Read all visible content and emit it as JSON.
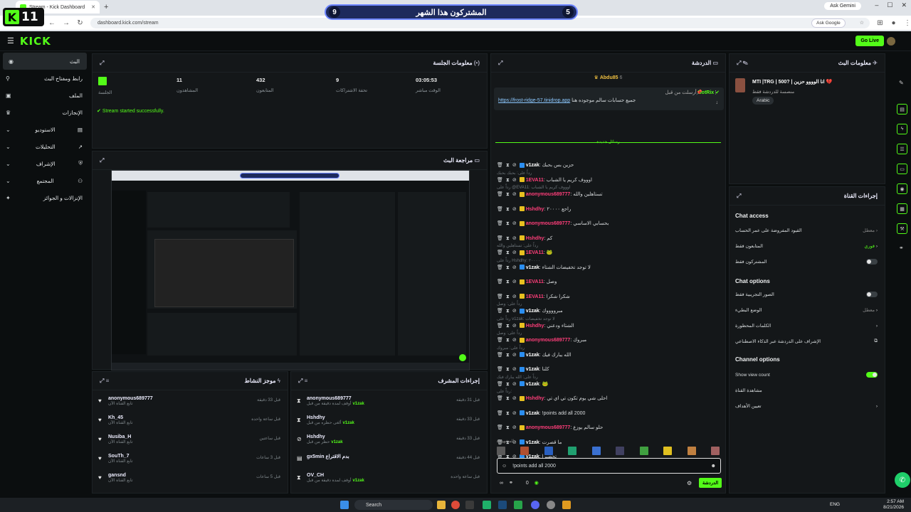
{
  "browser": {
    "tab_title": "Stream - Kick Dashboard",
    "url": "dashboard.kick.com/stream",
    "ask_google": "Ask Google",
    "ask_gemini": "Ask Gemini"
  },
  "overlay": {
    "k_letter": "K",
    "k_count": "11",
    "sub_left": "9",
    "sub_label": "المشتركون هذا الشهر",
    "sub_right": "5"
  },
  "header": {
    "logo": "KICK",
    "go_live": "Go Live"
  },
  "sidebar": {
    "items": [
      {
        "label": "البث",
        "icon": "broadcast-icon"
      },
      {
        "label": "رابط ومفتاح البث",
        "icon": "link-icon"
      },
      {
        "label": "الملف",
        "icon": "profile-icon"
      },
      {
        "label": "الإنجازات",
        "icon": "trophy-icon"
      },
      {
        "label": "الاستوديو",
        "icon": "studio-icon"
      },
      {
        "label": "التحليلات",
        "icon": "analytics-icon"
      },
      {
        "label": "الإشراف",
        "icon": "shield-icon"
      },
      {
        "label": "المجتمع",
        "icon": "community-icon"
      },
      {
        "label": "الإنزالات و الجوائز",
        "icon": "gift-icon"
      }
    ]
  },
  "session": {
    "title": "معلومات الجلسة",
    "stats": [
      {
        "value": "",
        "label": "الجلسة"
      },
      {
        "value": "11",
        "label": "المشاهدون"
      },
      {
        "value": "432",
        "label": "المتابعون"
      },
      {
        "value": "9",
        "label": "تحفة الاشتراكات"
      },
      {
        "value": "03:05:53",
        "label": "الوقت مباشر"
      }
    ],
    "status": "Stream started successfully."
  },
  "preview": {
    "title": "مراجعة البث"
  },
  "activity": {
    "title": "موجز النشاط",
    "rows": [
      {
        "name": "anonymous689777",
        "sub": "تابع القناة الآن",
        "time": "قبل 33 دقيقة"
      },
      {
        "name": "Kh_45",
        "sub": "تابع القناة الآن",
        "time": "قبل ساعة واحدة"
      },
      {
        "name": "Nusiba_H",
        "sub": "تابع القناة الآن",
        "time": "قبل ساعتين"
      },
      {
        "name": "SouTh_7",
        "sub": "تابع القناة الآن",
        "time": "قبل 3 ساعات"
      },
      {
        "name": "gansnd",
        "sub": "تابع القناة الآن",
        "time": "قبل 5 ساعات"
      }
    ]
  },
  "modactions": {
    "title": "إجراءات المشرف",
    "rows": [
      {
        "name": "anonymous689777",
        "sub": "أوقف لمدة دقيقة من قبل",
        "by": "v1zak",
        "time": "قبل 31 دقيقة"
      },
      {
        "name": "Hshdhy",
        "sub": "ألغى حظره من قبل",
        "by": "v1zak",
        "time": "قبل 33 دقيقة"
      },
      {
        "name": "Hshdhy",
        "sub": "حظر من قبل",
        "by": "v1zak",
        "time": "قبل 33 دقيقة"
      },
      {
        "name": "gx5min",
        "sub": "بدم الاقتراع",
        "by": "",
        "time": "قبل 44 دقيقة"
      },
      {
        "name": "OV_CH",
        "sub": "أوقف لمدة دقيقة من قبل",
        "by": "v1zak",
        "time": "قبل ساعة واحدة"
      }
    ]
  },
  "chat": {
    "title": "الدردشة",
    "pinned_user": "Abdu85",
    "pinned_count": "6",
    "bot_label": "أرسلت من قبل",
    "bot_name": "BotRix",
    "bot_msg": "جميع حسابات سالم موجوده هنا",
    "bot_link": "https://frost-ridge-57.tinidrop.app",
    "new_messages": "رسائل جديدة",
    "lines": [
      {
        "reply": "",
        "user": "v1zak",
        "cls": "blue",
        "msg": "حزين بس بحبك"
      },
      {
        "reply": "رداً على: بحبك بحبك",
        "user": "1EVA11",
        "cls": "pink",
        "msg": "اوووف كريم يا الشباب"
      },
      {
        "reply": "رداً على @EVA11: اوووف كريم يا الشباب",
        "user": "anonymous689777",
        "cls": "pink",
        "msg": "تستاهلين والله"
      },
      {
        "reply": "",
        "user": "Hshdhy",
        "cls": "pink",
        "msg": "راجع ٢٠٠٠٠"
      },
      {
        "reply": "",
        "user": "anonymous689777",
        "cls": "pink",
        "msg": "بحسابي الاساسي"
      },
      {
        "reply": "",
        "user": "Hshdhy",
        "cls": "pink",
        "msg": "كم"
      },
      {
        "reply": "رداً على: تستاهلين والله",
        "user": "1EVA11",
        "cls": "pink",
        "msg": "🐸"
      },
      {
        "reply": "رداً على Hshdhy: ٢٠٠٠٠",
        "user": "v1zak",
        "cls": "blue",
        "msg": "لا توجد تخفيضات الشتاء"
      },
      {
        "reply": "",
        "user": "1EVA11",
        "cls": "pink",
        "msg": "وصل"
      },
      {
        "reply": "",
        "user": "1EVA11",
        "cls": "pink",
        "msg": "شكرا شكرا"
      },
      {
        "reply": "رداً على: وصل",
        "user": "v1zak",
        "cls": "blue",
        "msg": "مبرووووك"
      },
      {
        "reply": "رداً على v1zak: لا توجد تخفيضات",
        "user": "Hshdhy",
        "cls": "pink",
        "msg": "الشتاء ودعني"
      },
      {
        "reply": "رداً على: وصل",
        "user": "anonymous689777",
        "cls": "pink",
        "msg": "مبروك"
      },
      {
        "reply": "رداً على: مبروك",
        "user": "v1zak",
        "cls": "blue",
        "msg": "الله يبارك فيك"
      },
      {
        "reply": "",
        "user": "v1zak",
        "cls": "blue",
        "msg": "كلنا"
      },
      {
        "reply": "رداً على: الله يبارك فيك",
        "user": "v1zak",
        "cls": "blue",
        "msg": "🐸"
      },
      {
        "reply": "رداً على: ",
        "user": "Hshdhy",
        "cls": "pink",
        "msg": "احلى شي يوم تكون تي اي تي"
      },
      {
        "reply": "",
        "user": "v1zak",
        "cls": "blue",
        "msg": "!points add all 2000"
      },
      {
        "reply": "",
        "user": "anonymous689777",
        "cls": "pink",
        "msg": "حلو سالم يوزع"
      },
      {
        "reply": "",
        "user": "v1zak",
        "cls": "blue",
        "msg": "ما قصرت"
      },
      {
        "reply": "",
        "user": "v1zak",
        "cls": "blue",
        "msg": "تحضيرا"
      }
    ],
    "emote_label": "المشهورة",
    "input_value": "!points add all 2000",
    "points": "0",
    "send_label": "الدردشة"
  },
  "streaminfo": {
    "title": "معلومات البث",
    "stream_title": "MTI |TRG | 500? | انا الوووو حزين 💔",
    "category": "منصسة للدردشة فقط",
    "language": "Arabic"
  },
  "chatsettings": {
    "title": "إجراءات القناة",
    "access_title": "Chat access",
    "access_rows": [
      {
        "label": "القيود المفروضة على عمر الحساب",
        "value": "معطل"
      },
      {
        "label": "المتابعون فقط",
        "value": "فوري"
      },
      {
        "label": "المشتركون فقط",
        "value": ""
      }
    ],
    "options_title": "Chat options",
    "options_rows": [
      {
        "label": "الصور التجريبية فقط",
        "value": ""
      },
      {
        "label": "الوضع البطيء",
        "value": "معطل"
      },
      {
        "label": "الكلمات المحظورة",
        "value": ""
      },
      {
        "label": "الإشراف على الدردشة عبر الذكاء الاصطناعي",
        "value": ""
      }
    ],
    "channel_title": "Channel options",
    "channel_rows": [
      {
        "label": "Show view count",
        "value": ""
      },
      {
        "label": "مشاهدة القناة",
        "value": ""
      },
      {
        "label": "تعيين الأهداف",
        "value": ""
      }
    ]
  },
  "taskbar": {
    "search": "Search",
    "lang": "ENG",
    "time": "2:57 AM",
    "date": "8/21/2026"
  },
  "colors": {
    "accent": "#53fc18",
    "bg": "#0b0e0f",
    "panel": "#141719"
  }
}
